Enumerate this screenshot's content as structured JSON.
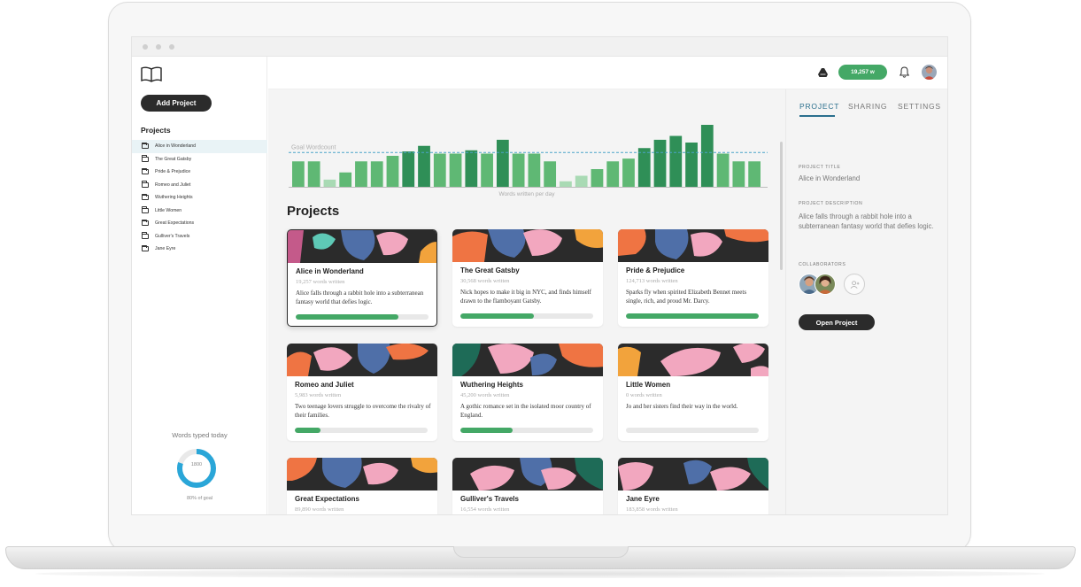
{
  "sidebar": {
    "add_project_label": "Add Project",
    "projects_title": "Projects",
    "projects": [
      "Alice in Wonderland",
      "The Great Gatsby",
      "Pride & Prejudice",
      "Romeo and Juliet",
      "Wuthering Heights",
      "Little Women",
      "Great Expectations",
      "Gulliver's Travels",
      "Jane Eyre"
    ],
    "active_project_index": 0,
    "words_today_label": "Words typed today",
    "words_today_value": "1800",
    "goal_percent_label": "80% of goal",
    "goal_fraction": 0.8
  },
  "header": {
    "wordcount_label": "19,257 w",
    "icons": [
      "drive-icon",
      "bell-icon",
      "user-avatar"
    ]
  },
  "main": {
    "heading": "Projects",
    "cards": [
      {
        "title": "Alice in Wonderland",
        "words": "19,257 words written",
        "desc": "Alice falls through a rabbit hole into a subterranean fantasy world that defies logic.",
        "progress": 0.77,
        "selected": true
      },
      {
        "title": "The Great Gatsby",
        "words": "30,568 words written",
        "desc": "Nick hopes to make it big in NYC, and finds himself drawn to the flamboyant Gatsby.",
        "progress": 0.55,
        "selected": false
      },
      {
        "title": "Pride & Prejudice",
        "words": "124,713 words written",
        "desc": "Sparks fly when spirited Elizabeth Bennet meets single, rich, and proud Mr. Darcy.",
        "progress": 1.0,
        "selected": false
      },
      {
        "title": "Romeo and Juliet",
        "words": "5,983 words written",
        "desc": "Two teenage lovers struggle to overcome the rivalry of their families.",
        "progress": 0.19,
        "selected": false
      },
      {
        "title": "Wuthering Heights",
        "words": "45,200 words written",
        "desc": "A gothic romance set in the isolated moor country of England.",
        "progress": 0.39,
        "selected": false
      },
      {
        "title": "Little Women",
        "words": "0 words written",
        "desc": "Jo and her sisters find their way in the world.",
        "progress": 0,
        "selected": false
      },
      {
        "title": "Great Expectations",
        "words": "89,890 words written",
        "desc": "",
        "progress": 0,
        "selected": false
      },
      {
        "title": "Gulliver's Travels",
        "words": "16,554 words written",
        "desc": "",
        "progress": 0,
        "selected": false
      },
      {
        "title": "Jane Eyre",
        "words": "183,858 words written",
        "desc": "",
        "progress": 0,
        "selected": false
      }
    ]
  },
  "chart_data": {
    "type": "bar",
    "goal_label": "Goal Wordcount",
    "xlabel": "Words written per day",
    "goal": 62,
    "ylim": [
      0,
      112
    ],
    "values": [
      46,
      46,
      13,
      26,
      46,
      46,
      56,
      64,
      74,
      60,
      60,
      66,
      60,
      85,
      60,
      60,
      46,
      10,
      20,
      32,
      46,
      51,
      70,
      85,
      92,
      80,
      112,
      60,
      46,
      46
    ],
    "colors": {
      "above_goal": "#2f8f57",
      "below_goal": "#5fb874",
      "low": "#a9dab4",
      "goal_line": "#4aa3c8"
    }
  },
  "panel": {
    "tabs": [
      "PROJECT",
      "SHARING",
      "SETTINGS"
    ],
    "active_tab": 0,
    "title_label": "PROJECT TITLE",
    "title_value": "Alice in Wonderland",
    "desc_label": "PROJECT DESCRIPTION",
    "desc_value": "Alice falls through a rabbit hole into a subterranean fantasy world that defies logic.",
    "collab_label": "COLLABORATORS",
    "open_label": "Open Project"
  },
  "colors": {
    "accent": "#44a866",
    "tab_accent": "#2a6f8d",
    "dark_button": "#2b2b2b",
    "donut": "#2aa6d8",
    "art_palette": [
      "#2b2b2b",
      "#f2a7bf",
      "#4f6fa8",
      "#ef7443",
      "#f2a33c",
      "#1e6b57",
      "#5ec9b6",
      "#c45a8a"
    ]
  }
}
